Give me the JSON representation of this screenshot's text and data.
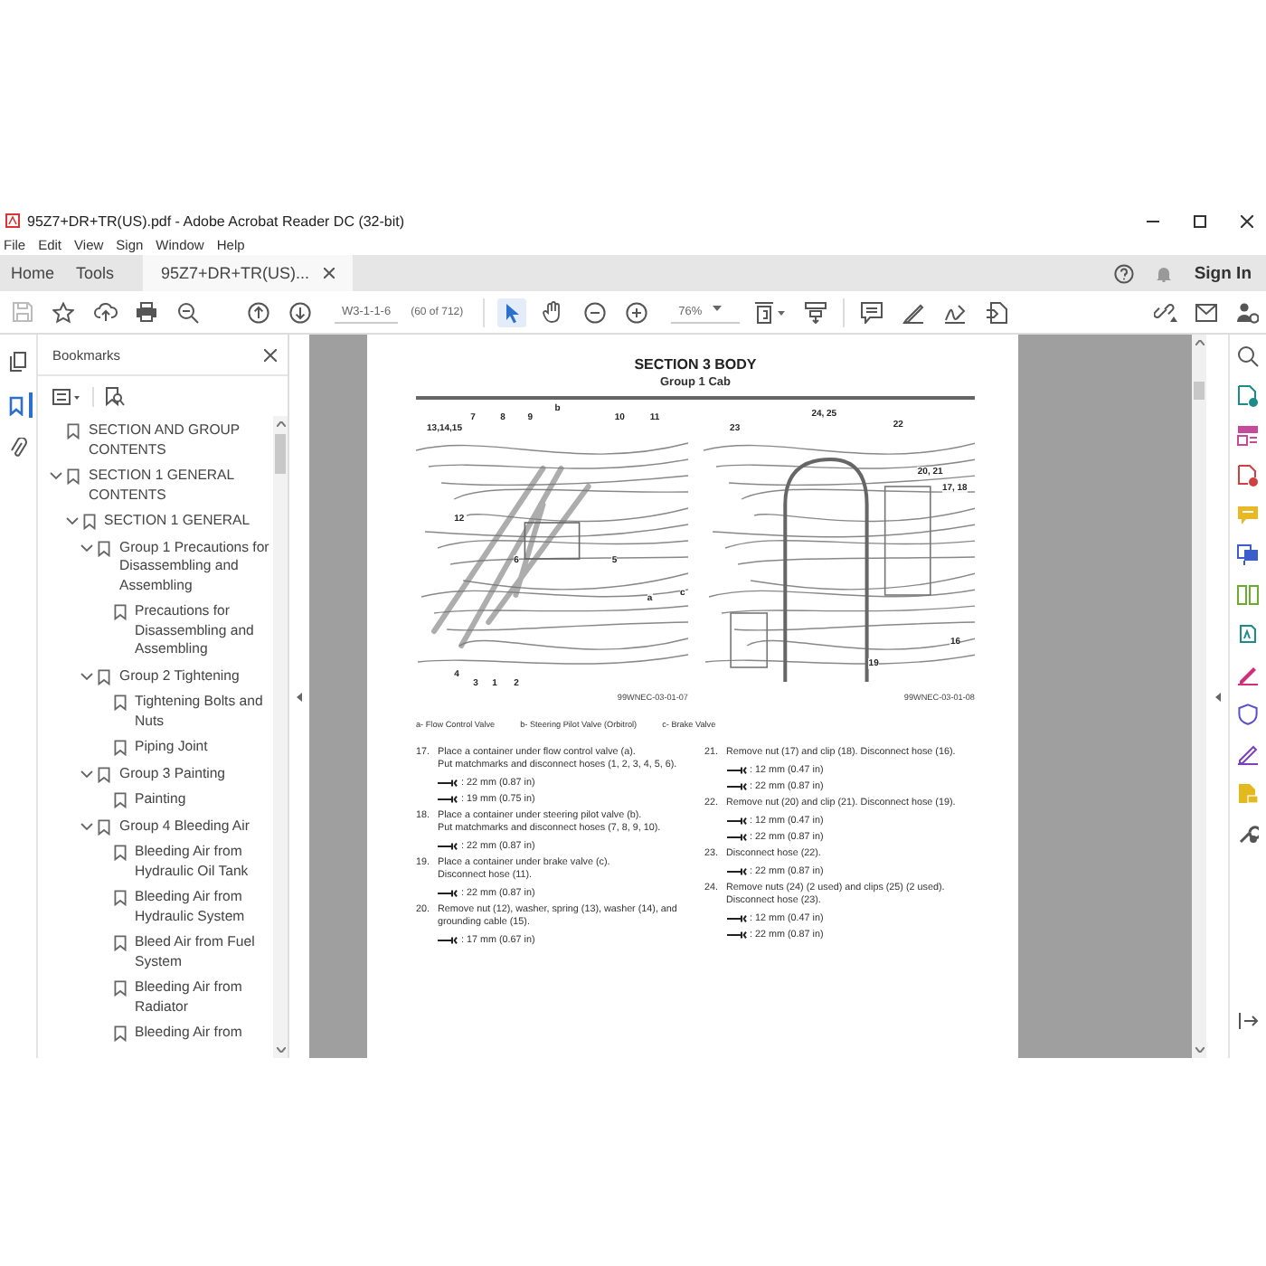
{
  "window": {
    "title": "95Z7+DR+TR(US).pdf - Adobe Acrobat Reader DC (32-bit)"
  },
  "menu": [
    "File",
    "Edit",
    "View",
    "Sign",
    "Window",
    "Help"
  ],
  "tabs": [
    {
      "label": "Home",
      "selected": false
    },
    {
      "label": "Tools",
      "selected": false
    },
    {
      "label": "95Z7+DR+TR(US)...",
      "selected": true,
      "closable": true
    }
  ],
  "account": {
    "sign_in": "Sign In"
  },
  "toolbar": {
    "page_label": "W3-1-1-6",
    "page_count": "(60 of 712)",
    "zoom": "76%",
    "tools": [
      {
        "kind": "select",
        "selected": true
      },
      {
        "kind": "hand",
        "selected": false
      }
    ]
  },
  "left_rail": [
    {
      "kind": "pages",
      "selected": false
    },
    {
      "kind": "bookmarks",
      "selected": true
    },
    {
      "kind": "attachments",
      "selected": false
    }
  ],
  "bookmarks": {
    "title": "Bookmarks",
    "items": [
      {
        "label": "SECTION AND GROUP CONTENTS"
      },
      {
        "label": "SECTION 1 GENERAL CONTENTS",
        "expanded": true,
        "children": [
          {
            "label": "SECTION 1 GENERAL",
            "expanded": true,
            "children": [
              {
                "label": "Group 1 Precautions for Disassembling and Assembling",
                "expanded": true,
                "children": [
                  {
                    "label": "Precautions for Disassembling and Assembling"
                  }
                ]
              },
              {
                "label": "Group 2 Tightening",
                "expanded": true,
                "children": [
                  {
                    "label": "Tightening Bolts and Nuts"
                  },
                  {
                    "label": "Piping Joint"
                  }
                ]
              },
              {
                "label": "Group 3 Painting",
                "expanded": true,
                "children": [
                  {
                    "label": "Painting"
                  }
                ]
              },
              {
                "label": "Group 4 Bleeding Air",
                "expanded": true,
                "children": [
                  {
                    "label": "Bleeding Air from Hydraulic Oil Tank"
                  },
                  {
                    "label": "Bleeding Air from Hydraulic System"
                  },
                  {
                    "label": "Bleed Air from Fuel System"
                  },
                  {
                    "label": "Bleeding Air from Radiator"
                  },
                  {
                    "label": "Bleeding Air from"
                  }
                ]
              }
            ]
          }
        ]
      }
    ]
  },
  "document": {
    "section_title": "SECTION 3 BODY",
    "group_title": "Group 1 Cab",
    "figures": [
      {
        "callouts": [
          "13,14,15",
          "7",
          "8",
          "9",
          "b",
          "10",
          "11",
          "12",
          "6",
          "5",
          "a",
          "c",
          "4",
          "3",
          "1",
          "2"
        ],
        "figure_id": "99WNEC-03-01-07"
      },
      {
        "callouts": [
          "23",
          "24, 25",
          "22",
          "20, 21",
          "17, 18",
          "16",
          "19"
        ],
        "figure_id": "99WNEC-03-01-08"
      }
    ],
    "legend": [
      "a- Flow Control Valve",
      "b- Steering Pilot Valve (Orbitrol)",
      "c- Brake Valve"
    ],
    "steps_left": [
      {
        "number": "17.",
        "lines": [
          "Place a container under flow control valve (a).",
          "Put matchmarks and disconnect hoses (1, 2, 3, 4, 5, 6)."
        ],
        "wrench_sizes": [
          ": 22 mm (0.87 in)",
          ": 19 mm (0.75 in)"
        ]
      },
      {
        "number": "18.",
        "lines": [
          "Place a container under steering pilot valve (b).",
          "Put matchmarks and disconnect hoses (7, 8, 9, 10)."
        ],
        "wrench_sizes": [
          ": 22 mm (0.87 in)"
        ]
      },
      {
        "number": "19.",
        "lines": [
          "Place a container under brake valve (c).",
          "Disconnect hose (11)."
        ],
        "wrench_sizes": [
          ": 22 mm (0.87 in)"
        ]
      },
      {
        "number": "20.",
        "lines": [
          "Remove nut (12), washer, spring (13), washer (14), and grounding cable (15)."
        ],
        "wrench_sizes": [
          ": 17 mm (0.67 in)"
        ]
      }
    ],
    "steps_right": [
      {
        "number": "21.",
        "lines": [
          "Remove nut (17) and clip (18). Disconnect hose (16)."
        ],
        "wrench_sizes": [
          ": 12 mm (0.47 in)",
          ": 22 mm (0.87 in)"
        ]
      },
      {
        "number": "22.",
        "lines": [
          "Remove nut (20) and clip (21). Disconnect hose (19)."
        ],
        "wrench_sizes": [
          ": 12 mm (0.47 in)",
          ": 22 mm (0.87 in)"
        ]
      },
      {
        "number": "23.",
        "lines": [
          "Disconnect hose (22)."
        ],
        "wrench_sizes": [
          ": 22 mm (0.87 in)"
        ]
      },
      {
        "number": "24.",
        "lines": [
          "Remove nuts (24) (2 used) and clips (25) (2 used).",
          "Disconnect hose (23)."
        ],
        "wrench_sizes": [
          ": 12 mm (0.47 in)",
          ": 22 mm (0.87 in)"
        ]
      }
    ]
  }
}
